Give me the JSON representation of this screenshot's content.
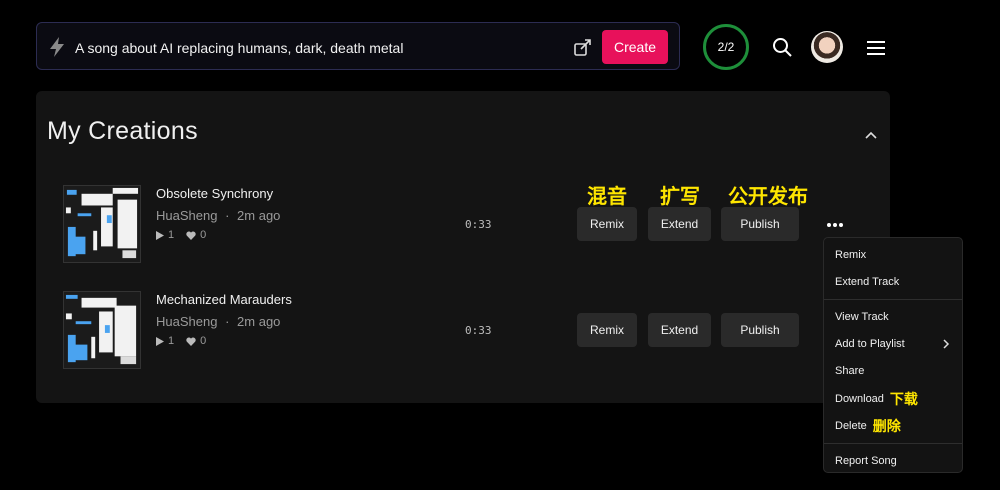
{
  "prompt": {
    "text": "A song about AI replacing humans, dark, death metal",
    "create_label": "Create"
  },
  "header": {
    "credits": "2/2"
  },
  "panel": {
    "title": "My Creations"
  },
  "tracks": [
    {
      "title": "Obsolete Synchrony",
      "artist": "HuaSheng",
      "separator": "·",
      "age": "2m ago",
      "plays": "1",
      "likes": "0",
      "duration": "0:33",
      "remix_label": "Remix",
      "extend_label": "Extend",
      "publish_label": "Publish"
    },
    {
      "title": "Mechanized Marauders",
      "artist": "HuaSheng",
      "separator": "·",
      "age": "2m ago",
      "plays": "1",
      "likes": "0",
      "duration": "0:33",
      "remix_label": "Remix",
      "extend_label": "Extend",
      "publish_label": "Publish"
    }
  ],
  "annotations": {
    "remix": "混音",
    "extend": "扩写",
    "publish": "公开发布",
    "download": "下载",
    "delete": "删除"
  },
  "context_menu": {
    "remix": "Remix",
    "extend_track": "Extend Track",
    "view_track": "View Track",
    "add_to_playlist": "Add to Playlist",
    "share": "Share",
    "download": "Download",
    "delete": "Delete",
    "report_song": "Report Song"
  },
  "colors": {
    "accent": "#e8115b",
    "credits_ring": "#1e8f3a",
    "annotation": "#ffe600",
    "cover_blue": "#4aa3f0"
  }
}
